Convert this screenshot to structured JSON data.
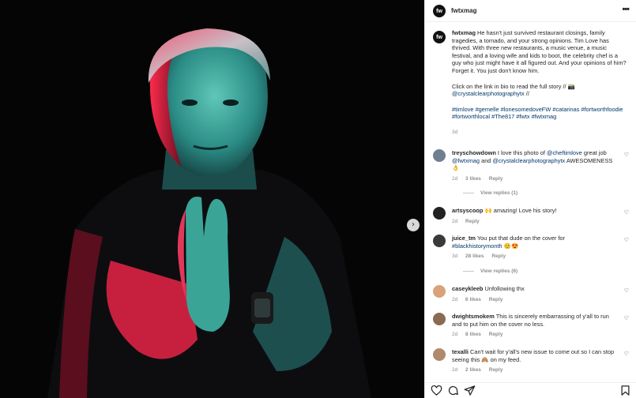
{
  "post": {
    "username": "fwtxmag",
    "avatar_initials": "fw",
    "more_icon": "more-horizontal-icon",
    "next_icon": "chevron-right-icon"
  },
  "caption": {
    "username": "fwtxmag",
    "text": "He hasn't just survived restaurant closings, family tragedies, a tornado, and your strong opinions. Tim Love has thrived. With three new restaurants, a music venue, a music festival, and a loving wife and kids to boot, the celebrity chef is a guy who just might have it all figured out. And your opinions of him? Forget it. You just don't know him.",
    "cta": "Click on the link in bio to read the full story // 📸",
    "credit": "@crystalclearphotographytx",
    "credit_suffix": " //",
    "hashtags": "#timlove #gemelle #lonesomedoveFW #catarinas #fortworthfoodie #fortworthlocal #The817 #fwtx #fwtxmag",
    "time": "3d"
  },
  "comments": [
    {
      "username": "treyschowdown",
      "pre": "I love this photo of ",
      "mention1": "@cheftimlove",
      "mid": " great job ",
      "mention2": "@fwtxmag",
      "mid2": " and ",
      "mention3": "@crystalclearphotographytx",
      "post": " AWESOMENESS 👌",
      "time": "2d",
      "likes": "3 likes",
      "reply": "Reply",
      "view_replies": "View replies (1)",
      "avatar_color": "#6f7f8f"
    },
    {
      "username": "artsyscoop",
      "text": "🙌 amazing! Love his story!",
      "time": "2d",
      "reply": "Reply",
      "avatar_color": "#222222"
    },
    {
      "username": "juice_tm",
      "text": "You put that dude on the cover for ",
      "hashtag": "#blackhistorymonth",
      "emoji": " 😊😍",
      "time": "3d",
      "likes": "28 likes",
      "reply": "Reply",
      "view_replies": "View replies (6)",
      "avatar_color": "#3a3a3a"
    },
    {
      "username": "caseykleeb",
      "text": "Unfollowing thx",
      "time": "2d",
      "likes": "6 likes",
      "reply": "Reply",
      "avatar_color": "#d9a27a"
    },
    {
      "username": "dwightsmokem",
      "text": "This is sincerely embarrassing of y'all to run and to put him on the cover no less.",
      "time": "2d",
      "likes": "8 likes",
      "reply": "Reply",
      "avatar_color": "#8a6a52"
    },
    {
      "username": "texalli",
      "text": "Can't wait for y'all's new issue to come out so I can stop seeing this 🙈 on my feed.",
      "time": "2d",
      "likes": "2 likes",
      "reply": "Reply",
      "avatar_color": "#b08a6a"
    }
  ],
  "actions": [
    "heart-icon",
    "comment-icon",
    "share-icon",
    "bookmark-icon"
  ],
  "colors": {
    "link": "#00376b",
    "muted": "#8e8e8e",
    "text": "#262626",
    "red_light": "#e0264a",
    "teal_light": "#2f9f9a"
  }
}
